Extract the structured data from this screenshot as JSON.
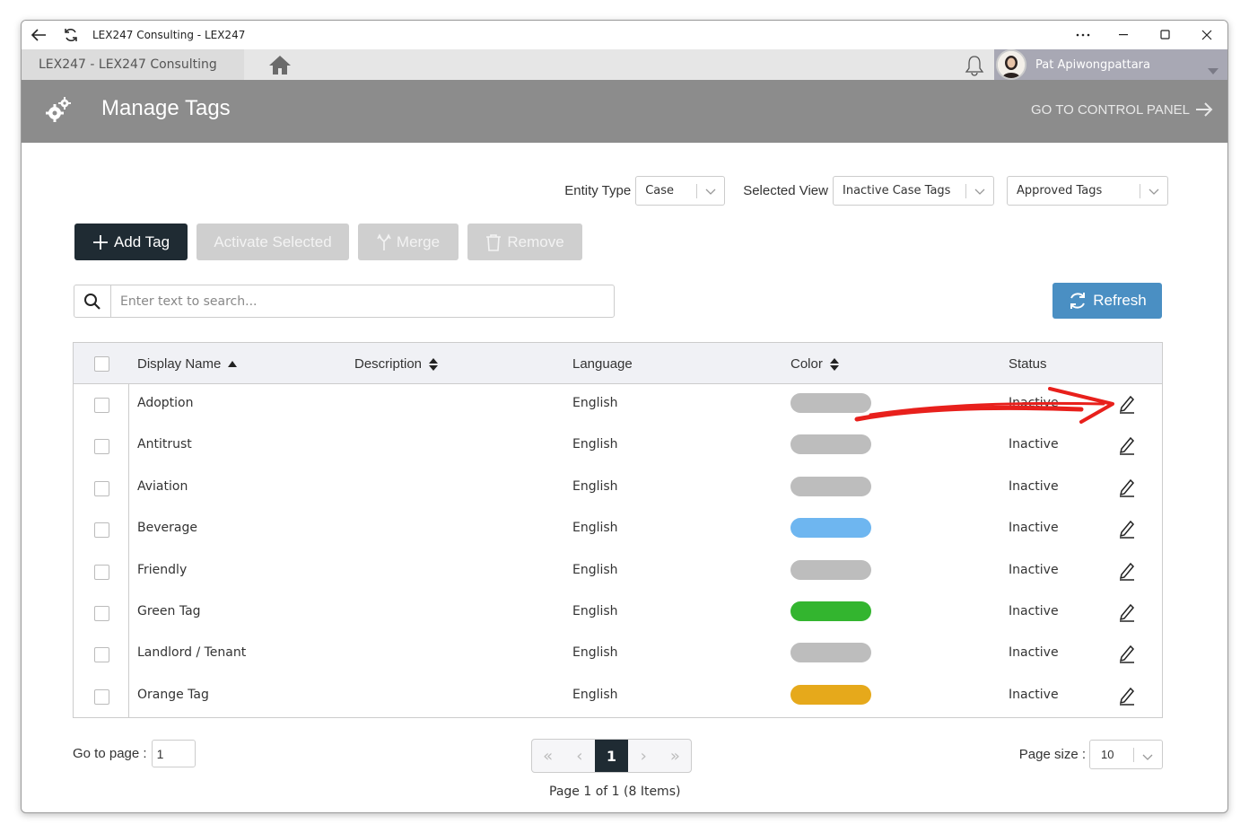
{
  "window": {
    "title": "LEX247 Consulting - LEX247"
  },
  "tabbar": {
    "tab_label": "LEX247   -  LEX247 Consulting",
    "user_name": "Pat Apiwongpattara"
  },
  "header": {
    "page_title": "Manage Tags",
    "control_panel_label": "GO TO CONTROL PANEL"
  },
  "filters": {
    "entity_type_label": "Entity Type",
    "entity_type_value": "Case",
    "selected_view_label": "Selected View",
    "selected_view_value": "Inactive Case Tags",
    "approval_value": "Approved Tags"
  },
  "toolbar": {
    "add_label": "Add Tag",
    "activate_label": "Activate Selected",
    "merge_label": "Merge",
    "remove_label": "Remove",
    "refresh_label": "Refresh"
  },
  "search": {
    "placeholder": "Enter text to search..."
  },
  "table": {
    "columns": [
      "Display Name",
      "Description",
      "Language",
      "Color",
      "Status"
    ],
    "rows": [
      {
        "name": "Adoption",
        "description": "",
        "language": "English",
        "color": "#bdbdbd",
        "status": "Inactive"
      },
      {
        "name": "Antitrust",
        "description": "",
        "language": "English",
        "color": "#bdbdbd",
        "status": "Inactive"
      },
      {
        "name": "Aviation",
        "description": "",
        "language": "English",
        "color": "#bdbdbd",
        "status": "Inactive"
      },
      {
        "name": "Beverage",
        "description": "",
        "language": "English",
        "color": "#6eb6f0",
        "status": "Inactive"
      },
      {
        "name": "Friendly",
        "description": "",
        "language": "English",
        "color": "#bdbdbd",
        "status": "Inactive"
      },
      {
        "name": "Green Tag",
        "description": "",
        "language": "English",
        "color": "#33b52f",
        "status": "Inactive"
      },
      {
        "name": "Landlord / Tenant",
        "description": "",
        "language": "English",
        "color": "#bdbdbd",
        "status": "Inactive"
      },
      {
        "name": "Orange Tag",
        "description": "",
        "language": "English",
        "color": "#e6a91b",
        "status": "Inactive"
      }
    ]
  },
  "pager": {
    "goto_label": "Go to page :",
    "goto_value": "1",
    "current_page": "1",
    "info": "Page 1 of 1 (8 Items)",
    "page_size_label": "Page size :",
    "page_size_value": "10"
  },
  "colors": {
    "header_bg": "#8c8c8c",
    "primary_btn": "#1f2b33",
    "refresh_btn": "#4a8fc3",
    "annotation_arrow": "#e8201c"
  }
}
